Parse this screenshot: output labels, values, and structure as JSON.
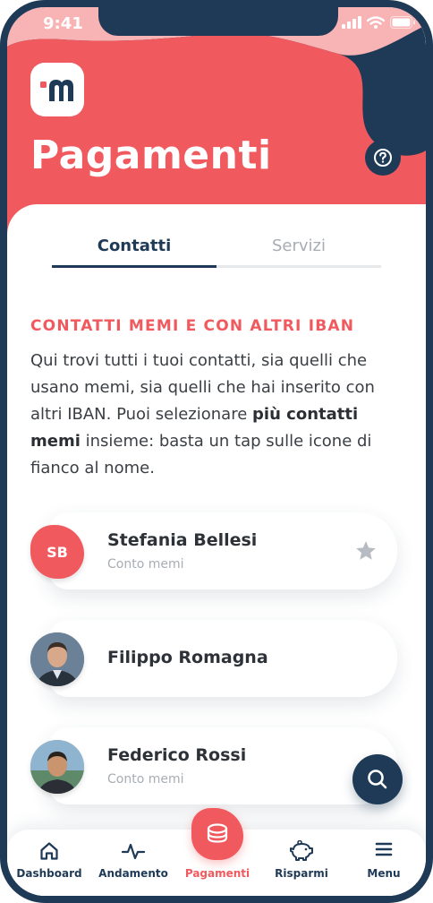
{
  "status_bar": {
    "time": "9:41"
  },
  "header": {
    "title": "Pagamenti"
  },
  "tabs": [
    {
      "label": "Contatti",
      "active": true
    },
    {
      "label": "Servizi",
      "active": false
    }
  ],
  "section": {
    "title": "CONTATTI MEMI E CON ALTRI IBAN",
    "description_part1": "Qui trovi tutti i tuoi contatti, sia quelli che usano memi, sia quelli che hai inserito con altri IBAN. Puoi selezionare ",
    "description_bold": "più contatti memi",
    "description_part2": " insieme: basta un tap sulle icone di fianco al nome."
  },
  "contacts": [
    {
      "name": "Stefania Bellesi",
      "subtitle": "Conto memi",
      "initials": "SB",
      "favorite": true
    },
    {
      "name": "Filippo Romagna",
      "subtitle": "",
      "initials": "",
      "favorite": false
    },
    {
      "name": "Federico Rossi",
      "subtitle": "Conto memi",
      "initials": "",
      "favorite": false
    }
  ],
  "nav": [
    {
      "label": "Dashboard",
      "icon": "home-icon"
    },
    {
      "label": "Andamento",
      "icon": "activity-icon"
    },
    {
      "label": "Pagamenti",
      "icon": "coins-icon",
      "active": true
    },
    {
      "label": "Risparmi",
      "icon": "piggy-bank-icon"
    },
    {
      "label": "Menu",
      "icon": "menu-icon"
    }
  ],
  "colors": {
    "brand_red": "#f05a5e",
    "navy": "#1f3a56",
    "pink": "#f8b3b4"
  }
}
